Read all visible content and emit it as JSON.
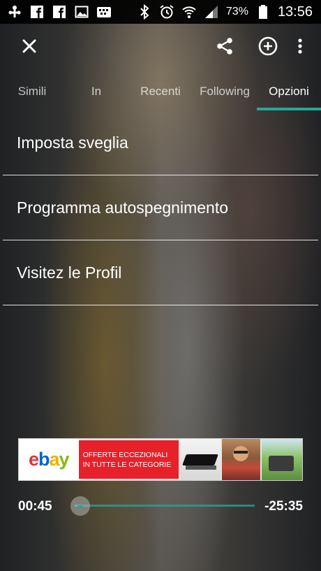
{
  "status_bar": {
    "left_icons": [
      "usb-debug-icon",
      "facebook-icon",
      "facebook-icon",
      "gallery-icon",
      "bbm-icon"
    ],
    "right_icons": [
      "bluetooth-icon",
      "alarm-icon",
      "wifi-icon",
      "signal-icon"
    ],
    "battery": "73%",
    "time": "13:56"
  },
  "toolbar": {
    "close_icon": "close-icon",
    "share_icon": "share-icon",
    "add_icon": "add-circle-icon",
    "more_icon": "more-vert-icon"
  },
  "tabs": [
    {
      "label": "Simili"
    },
    {
      "label": "In"
    },
    {
      "label": "Recenti"
    },
    {
      "label": "Following"
    },
    {
      "label": "Opzioni"
    }
  ],
  "active_tab": "Opzioni",
  "menu": {
    "items": [
      {
        "label": "Imposta sveglia"
      },
      {
        "label": "Programma autospegnimento"
      },
      {
        "label": "Visitez le Profil"
      }
    ]
  },
  "ad": {
    "brand_letters": [
      "e",
      "b",
      "a",
      "y"
    ],
    "offer_text": "OFFERTE ECCEZIONALI IN TUTTE LE CATEGORIE"
  },
  "player": {
    "elapsed": "00:45",
    "remaining": "-25:35",
    "progress_fraction": 0.03
  },
  "colors": {
    "accent": "#26a69a",
    "ad_red": "#e8202a",
    "ebay_e": "#e53238",
    "ebay_b": "#0064d2",
    "ebay_a": "#f5af02",
    "ebay_y": "#86b817"
  }
}
